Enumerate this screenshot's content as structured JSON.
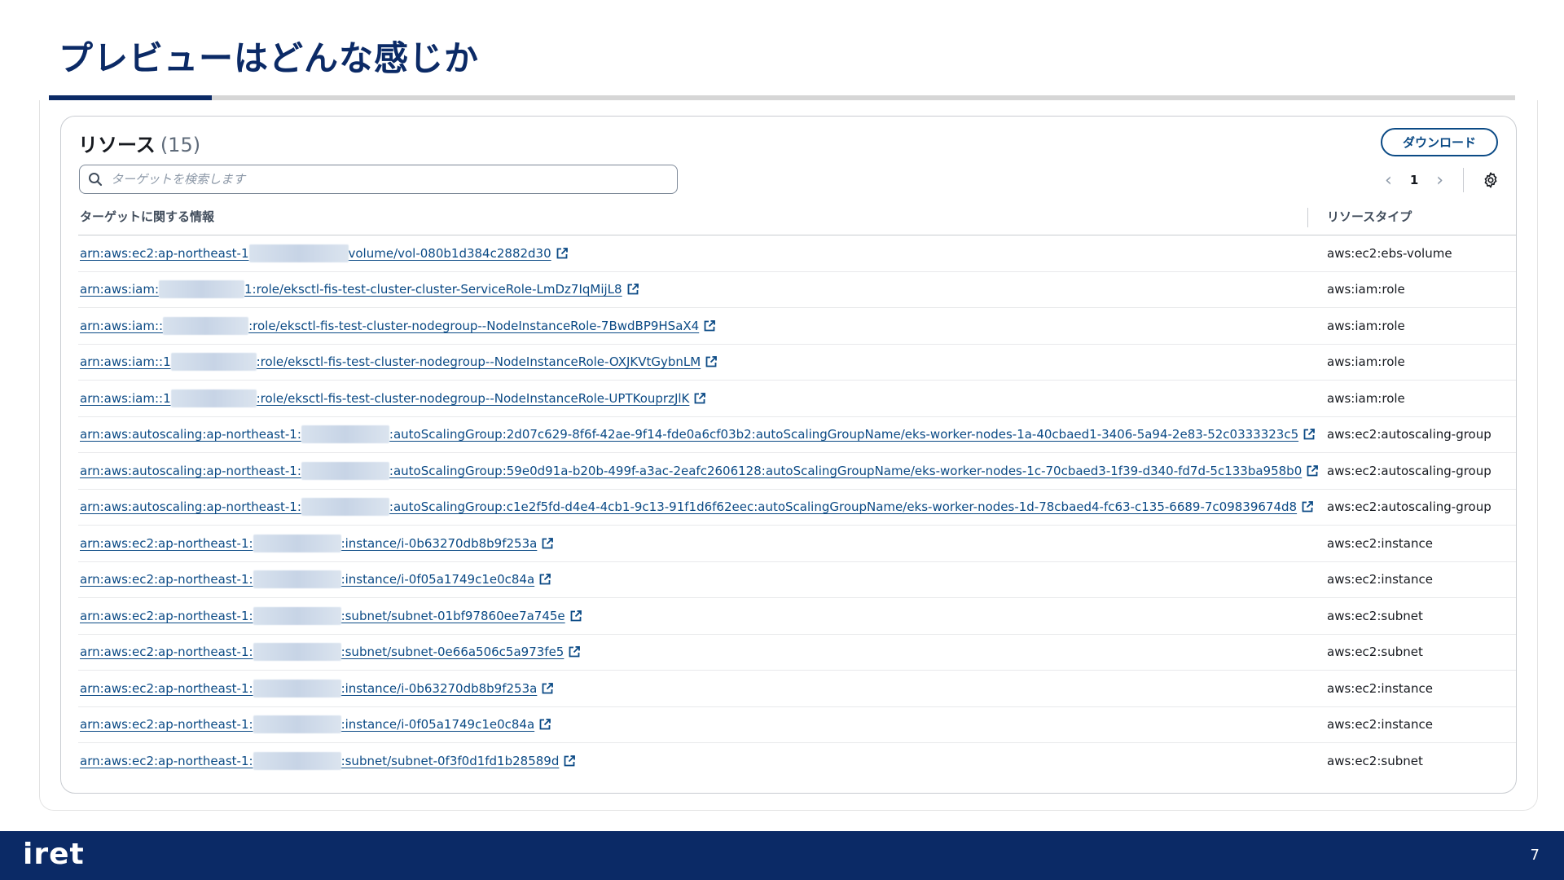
{
  "slide": {
    "title": "プレビューはどんな感じか",
    "page_number": "7",
    "logo_text": "iret"
  },
  "panel": {
    "title": "リソース",
    "count": "(15)",
    "download_label": "ダウンロード",
    "search_placeholder": "ターゲットを検索します",
    "current_page": "1",
    "columns": [
      "ターゲットに関する情報",
      "リソースタイプ"
    ]
  },
  "rows": [
    {
      "prefix": "arn:aws:ec2:ap-northeast-1",
      "suffix": "volume/vol-080b1d384c2882d30",
      "type": "aws:ec2:ebs-volume"
    },
    {
      "prefix": "arn:aws:iam:",
      "suffix": "1:role/eksctl-fis-test-cluster-cluster-ServiceRole-LmDz7IqMijL8",
      "type": "aws:iam:role"
    },
    {
      "prefix": "arn:aws:iam::",
      "suffix": ":role/eksctl-fis-test-cluster-nodegroup--NodeInstanceRole-7BwdBP9HSaX4",
      "type": "aws:iam:role"
    },
    {
      "prefix": "arn:aws:iam::1",
      "suffix": ":role/eksctl-fis-test-cluster-nodegroup--NodeInstanceRole-OXJKVtGybnLM",
      "type": "aws:iam:role"
    },
    {
      "prefix": "arn:aws:iam::1",
      "suffix": ":role/eksctl-fis-test-cluster-nodegroup--NodeInstanceRole-UPTKouprzJlK",
      "type": "aws:iam:role"
    },
    {
      "prefix": "arn:aws:autoscaling:ap-northeast-1:",
      "suffix": ":autoScalingGroup:2d07c629-8f6f-42ae-9f14-fde0a6cf03b2:autoScalingGroupName/eks-worker-nodes-1a-40cbaed1-3406-5a94-2e83-52c0333323c5",
      "type": "aws:ec2:autoscaling-group"
    },
    {
      "prefix": "arn:aws:autoscaling:ap-northeast-1:",
      "suffix": ":autoScalingGroup:59e0d91a-b20b-499f-a3ac-2eafc2606128:autoScalingGroupName/eks-worker-nodes-1c-70cbaed3-1f39-d340-fd7d-5c133ba958b0",
      "type": "aws:ec2:autoscaling-group"
    },
    {
      "prefix": "arn:aws:autoscaling:ap-northeast-1:",
      "suffix": ":autoScalingGroup:c1e2f5fd-d4e4-4cb1-9c13-91f1d6f62eec:autoScalingGroupName/eks-worker-nodes-1d-78cbaed4-fc63-c135-6689-7c09839674d8",
      "type": "aws:ec2:autoscaling-group"
    },
    {
      "prefix": "arn:aws:ec2:ap-northeast-1:",
      "suffix": ":instance/i-0b63270db8b9f253a",
      "type": "aws:ec2:instance"
    },
    {
      "prefix": "arn:aws:ec2:ap-northeast-1:",
      "suffix": ":instance/i-0f05a1749c1e0c84a",
      "type": "aws:ec2:instance"
    },
    {
      "prefix": "arn:aws:ec2:ap-northeast-1:",
      "suffix": ":subnet/subnet-01bf97860ee7a745e",
      "type": "aws:ec2:subnet"
    },
    {
      "prefix": "arn:aws:ec2:ap-northeast-1:",
      "suffix": ":subnet/subnet-0e66a506c5a973fe5",
      "type": "aws:ec2:subnet"
    },
    {
      "prefix": "arn:aws:ec2:ap-northeast-1:",
      "suffix": ":instance/i-0b63270db8b9f253a",
      "type": "aws:ec2:instance"
    },
    {
      "prefix": "arn:aws:ec2:ap-northeast-1:",
      "suffix": ":instance/i-0f05a1749c1e0c84a",
      "type": "aws:ec2:instance"
    },
    {
      "prefix": "arn:aws:ec2:ap-northeast-1:",
      "suffix": ":subnet/subnet-0f3f0d1fd1b28589d",
      "type": "aws:ec2:subnet"
    }
  ],
  "colors": {
    "title": "#0b2a66",
    "link": "#0b4a85",
    "footer": "#0b2a66"
  },
  "icons": [
    "search-icon",
    "chevron-left-icon",
    "chevron-right-icon",
    "gear-icon",
    "external-link-icon"
  ]
}
